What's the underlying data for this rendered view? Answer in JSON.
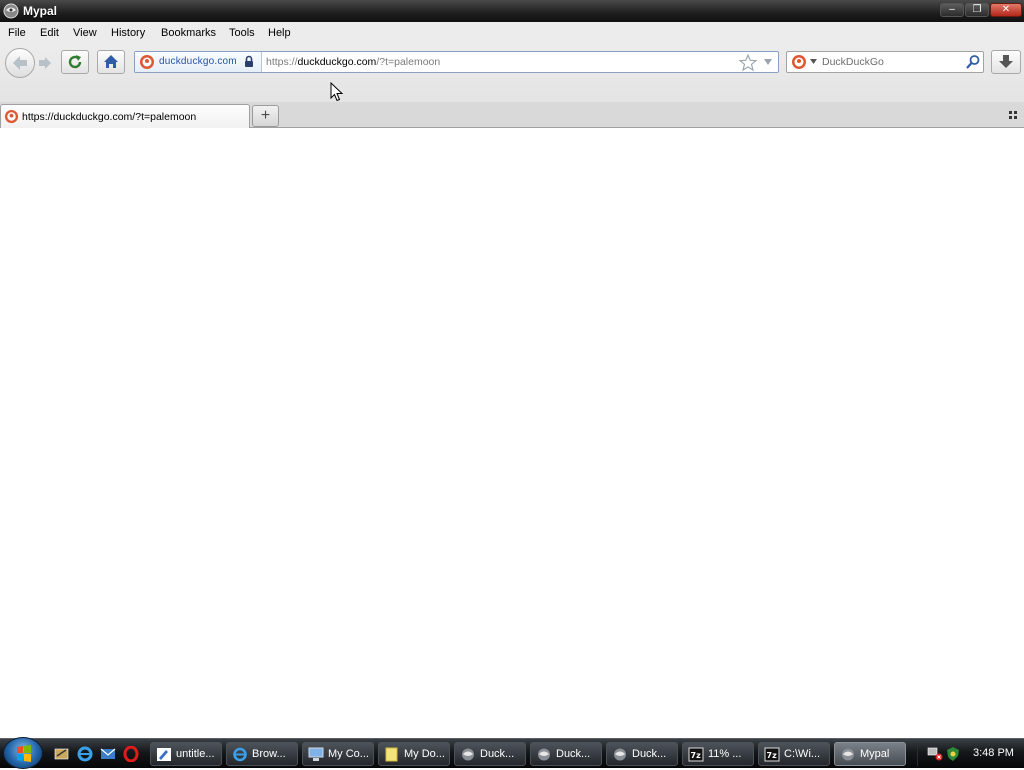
{
  "window": {
    "title": "Mypal",
    "minimize_label": "–",
    "restore_label": "❐",
    "close_label": "✕"
  },
  "menubar": {
    "items": [
      {
        "label": "File"
      },
      {
        "label": "Edit"
      },
      {
        "label": "View"
      },
      {
        "label": "History"
      },
      {
        "label": "Bookmarks"
      },
      {
        "label": "Tools"
      },
      {
        "label": "Help"
      }
    ]
  },
  "navbar": {
    "identity_domain": "duckduckgo.com",
    "url_scheme": "https://",
    "url_host": "duckduckgo.com",
    "url_rest": "/?t=palemoon",
    "search_placeholder": "DuckDuckGo"
  },
  "tabs": {
    "items": [
      {
        "label": "https://duckduckgo.com/?t=palemoon",
        "active": true
      }
    ],
    "new_tab_label": "+"
  },
  "taskbar": {
    "tasks": [
      {
        "label": "untitle...",
        "icon": "paint-icon"
      },
      {
        "label": "Brow...",
        "icon": "ie-icon"
      },
      {
        "label": "My Co...",
        "icon": "computer-icon"
      },
      {
        "label": "My Do...",
        "icon": "folder-icon"
      },
      {
        "label": "Duck...",
        "icon": "mypal-icon"
      },
      {
        "label": "Duck...",
        "icon": "mypal-icon"
      },
      {
        "label": "Duck...",
        "icon": "mypal-icon"
      },
      {
        "label": "11% ...",
        "icon": "7zip-icon"
      },
      {
        "label": "C:\\Wi...",
        "icon": "7zip-icon"
      },
      {
        "label": "Mypal",
        "icon": "mypal-icon",
        "active": true
      }
    ],
    "clock": "3:48 PM"
  },
  "colors": {
    "accent": "#2553a1",
    "ddg_orange": "#de5833",
    "titlebar": "#1e1e1e"
  }
}
